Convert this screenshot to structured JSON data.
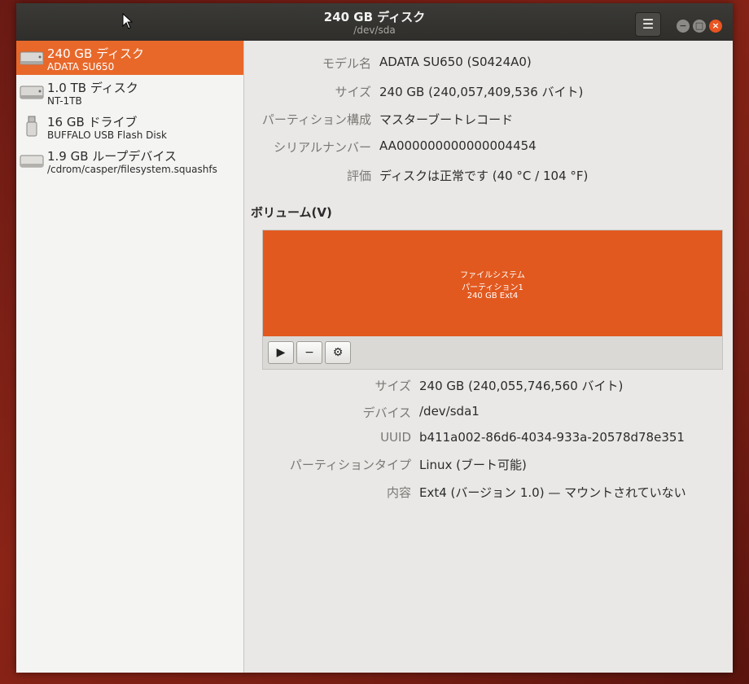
{
  "window": {
    "title": "240 GB ディスク",
    "subtitle": "/dev/sda"
  },
  "titlebar": {
    "menu_icon": "☰"
  },
  "sidebar": {
    "drives": [
      {
        "name": "240 GB ディスク",
        "sub": "ADATA SU650",
        "icon": "hard-disk-icon",
        "selected": true
      },
      {
        "name": "1.0 TB ディスク",
        "sub": "NT-1TB",
        "icon": "hard-disk-icon",
        "selected": false
      },
      {
        "name": "16 GB ドライブ",
        "sub": "BUFFALO USB Flash Disk",
        "icon": "usb-drive-icon",
        "selected": false
      },
      {
        "name": "1.9 GB ループデバイス",
        "sub": "/cdrom/casper/filesystem.squashfs",
        "icon": "loop-device-icon",
        "selected": false
      }
    ]
  },
  "disk": {
    "model_label": "モデル名",
    "model_value": "ADATA SU650 (S0424A0)",
    "size_label": "サイズ",
    "size_value": "240 GB (240,057,409,536 バイト)",
    "partitioning_label": "パーティション構成",
    "partitioning_value": "マスターブートレコード",
    "serial_label": "シリアルナンバー",
    "serial_value": "AA000000000000004454",
    "assessment_label": "評価",
    "assessment_value": "ディスクは正常です (40 °C / 104 °F)"
  },
  "volumes": {
    "title": "ボリューム(V)",
    "partition": {
      "line1": "ファイルシステム",
      "line2": "パーティション1",
      "line3": "240 GB Ext4"
    },
    "tools": {
      "mount_icon": "▶",
      "remove_icon": "−",
      "settings_icon": "⚙"
    }
  },
  "partition_info": {
    "size_label": "サイズ",
    "size_value": "240 GB (240,055,746,560 バイト)",
    "device_label": "デバイス",
    "device_value": "/dev/sda1",
    "uuid_label": "UUID",
    "uuid_value": "b411a002-86d6-4034-933a-20578d78e351",
    "type_label": "パーティションタイプ",
    "type_value": "Linux (ブート可能)",
    "contents_label": "内容",
    "contents_value": "Ext4 (バージョン 1.0) — マウントされていない"
  },
  "colors": {
    "accent": "#e95420",
    "titlebar": "#2f2e2b",
    "sidebar_bg": "#f4f4f3"
  }
}
